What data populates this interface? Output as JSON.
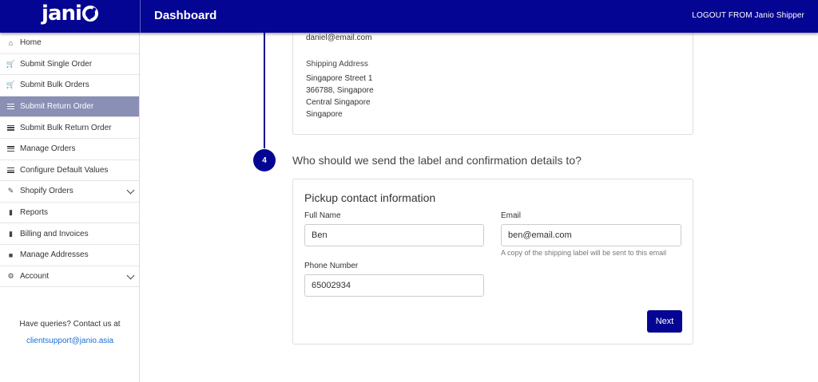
{
  "header": {
    "logo": "janio",
    "title": "Dashboard",
    "logout": "LOGOUT FROM Janio Shipper"
  },
  "sidebar": {
    "items": [
      {
        "label": "Home",
        "icon": "home-icon"
      },
      {
        "label": "Submit Single Order",
        "icon": "cart-icon"
      },
      {
        "label": "Submit Bulk Orders",
        "icon": "cart-icon"
      },
      {
        "label": "Submit Return Order",
        "icon": "list-icon",
        "active": true
      },
      {
        "label": "Submit Bulk Return Order",
        "icon": "list-icon"
      },
      {
        "label": "Manage Orders",
        "icon": "list-icon"
      },
      {
        "label": "Configure Default Values",
        "icon": "list-icon"
      },
      {
        "label": "Shopify Orders",
        "icon": "edit-icon",
        "expandable": true
      },
      {
        "label": "Reports",
        "icon": "document-icon"
      },
      {
        "label": "Billing and Invoices",
        "icon": "document-icon"
      },
      {
        "label": "Manage Addresses",
        "icon": "lock-icon"
      },
      {
        "label": "Account",
        "icon": "gear-icon",
        "expandable": true
      }
    ],
    "help_text": "Have queries? Contact us at",
    "help_email": "clientsupport@janio.asia"
  },
  "previous_card": {
    "email": "daniel@email.com",
    "shipping_address_label": "Shipping Address",
    "address_lines": [
      "Singapore Street 1",
      "366788, Singapore",
      "Central Singapore",
      "Singapore"
    ]
  },
  "step": {
    "number": "4",
    "question": "Who should we send the label and confirmation details to?"
  },
  "pickup_form": {
    "title": "Pickup contact information",
    "full_name_label": "Full Name",
    "full_name_value": "Ben",
    "email_label": "Email",
    "email_value": "ben@email.com",
    "email_help": "A copy of the shipping label will be sent to this email",
    "phone_label": "Phone Number",
    "phone_value": "65002934",
    "next_label": "Next"
  },
  "colors": {
    "primary": "#050593",
    "active_nav": "#8a8fb6",
    "link": "#1a6fd8"
  }
}
